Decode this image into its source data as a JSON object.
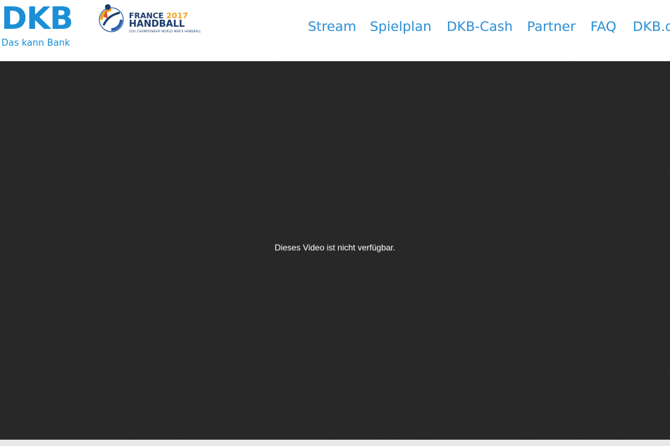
{
  "brand": {
    "name": "DKB",
    "tagline": "Das kann Bank",
    "color": "#1a8fd6"
  },
  "event": {
    "country": "FRANCE",
    "year": "2017",
    "sport": "HANDBALL",
    "subtitle": "25th CHAMPIONSHIP WORLD MEN'S HANDBALL",
    "emblem_icon": "handball-emblem-icon"
  },
  "nav": {
    "items": [
      {
        "label": "Stream"
      },
      {
        "label": "Spielplan"
      },
      {
        "label": "DKB-Cash"
      },
      {
        "label": "Partner"
      },
      {
        "label": "FAQ"
      },
      {
        "label": "DKB.de"
      }
    ],
    "color": "#2a8fd6"
  },
  "video": {
    "message": "Dieses Video ist nicht verfügbar.",
    "background": "#161616"
  }
}
